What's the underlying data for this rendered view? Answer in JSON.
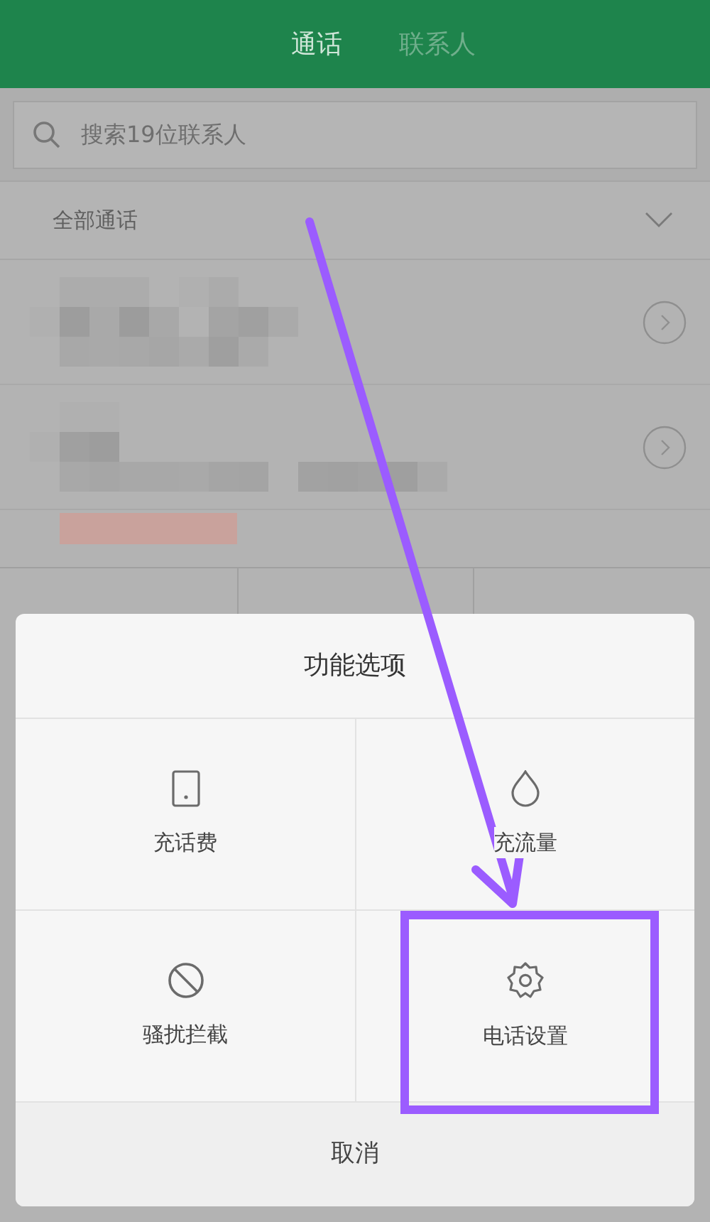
{
  "tabs": [
    {
      "label": "通话",
      "selected": true
    },
    {
      "label": "联系人",
      "selected": false
    }
  ],
  "search": {
    "placeholder": "搜索19位联系人"
  },
  "filter": {
    "label": "全部通话"
  },
  "dialog": {
    "title": "功能选项",
    "options": [
      {
        "label": "充话费",
        "kind": "phone"
      },
      {
        "label": "充流量",
        "kind": "drop"
      },
      {
        "label": "骚扰拦截",
        "kind": "block"
      },
      {
        "label": "电话设置",
        "kind": "settings"
      }
    ],
    "cancel": "取消"
  }
}
